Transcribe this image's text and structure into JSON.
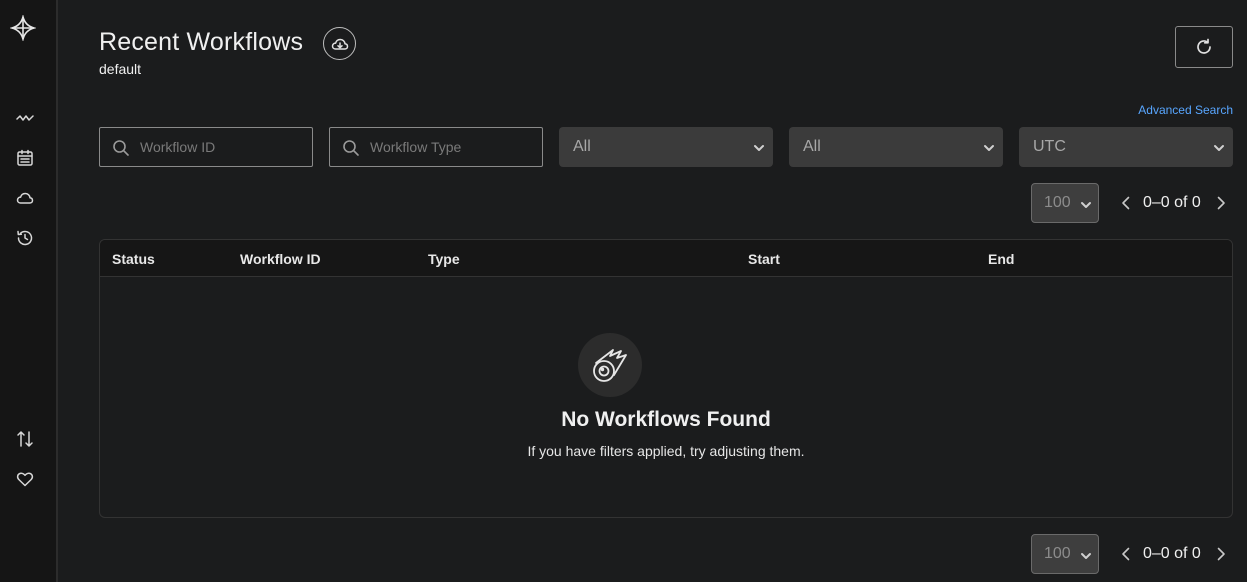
{
  "sidebar": {
    "logo_icon": "temporal-logo-icon",
    "nav": [
      {
        "name": "workflows-nav-icon",
        "icon": "pulse-icon"
      },
      {
        "name": "schedules-nav-icon",
        "icon": "calendar-icon"
      },
      {
        "name": "namespaces-nav-icon",
        "icon": "cloud-icon"
      },
      {
        "name": "archive-nav-icon",
        "icon": "history-icon"
      }
    ],
    "bottom": [
      {
        "name": "import-nav-icon",
        "icon": "arrows-updown-icon"
      },
      {
        "name": "feedback-nav-icon",
        "icon": "heart-icon"
      }
    ]
  },
  "header": {
    "title": "Recent Workflows",
    "namespace": "default",
    "advanced_search": "Advanced Search"
  },
  "filters": {
    "workflow_id_placeholder": "Workflow ID",
    "workflow_type_placeholder": "Workflow Type",
    "status_value": "All",
    "time_value": "All",
    "timezone_value": "UTC"
  },
  "pagination": {
    "page_size": "100",
    "range": "0–0 of 0"
  },
  "table": {
    "columns": [
      "Status",
      "Workflow ID",
      "Type",
      "Start",
      "End"
    ],
    "empty_title": "No Workflows Found",
    "empty_subtitle": "If you have filters applied, try adjusting them."
  },
  "colors": {
    "background": "#1b1c1d",
    "accent_link": "#58a6ff"
  }
}
